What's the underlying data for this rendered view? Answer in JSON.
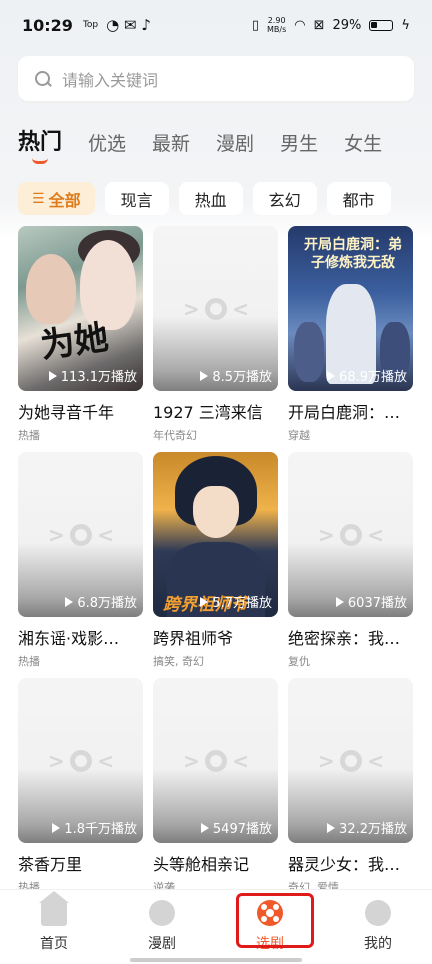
{
  "status_bar": {
    "time": "10:29",
    "mini_label": "Top",
    "net_speed_value": "2.90",
    "net_speed_unit": "MB/s",
    "battery_percent": "29%"
  },
  "search": {
    "placeholder": "请输入关键词"
  },
  "tabs": [
    {
      "label": "热门",
      "active": true
    },
    {
      "label": "优选"
    },
    {
      "label": "最新"
    },
    {
      "label": "漫剧"
    },
    {
      "label": "男生"
    },
    {
      "label": "女生"
    }
  ],
  "chips": [
    {
      "label": "全部",
      "active": true
    },
    {
      "label": "现言"
    },
    {
      "label": "热血"
    },
    {
      "label": "玄幻"
    },
    {
      "label": "都市"
    }
  ],
  "cards": [
    {
      "title": "为她寻音千年",
      "tag": "热播",
      "plays": "113.1万播放",
      "poster_text": "为她"
    },
    {
      "title": "1927 三湾来信",
      "tag": "年代奇幻",
      "plays": "8.5万播放"
    },
    {
      "title": "开局白鹿洞：弟子修炼我无敌",
      "tag": "穿越",
      "plays": "68.9万播放",
      "poster_text": "开局白鹿洞：弟子修炼我无敌"
    },
    {
      "title": "湘东谣·戏影…",
      "tag": "热播",
      "plays": "6.8万播放"
    },
    {
      "title": "跨界祖师爷",
      "tag": "搞笑, 奇幻",
      "plays": "5.7万播放",
      "poster_text": "跨界祖师爷"
    },
    {
      "title": "绝密探亲：我…",
      "tag": "复仇",
      "plays": "6037播放"
    },
    {
      "title": "茶香万里",
      "tag": "热播",
      "plays": "1.8千万播放"
    },
    {
      "title": "头等舱相亲记",
      "tag": "逆袭",
      "plays": "5497播放"
    },
    {
      "title": "器灵少女：我…",
      "tag": "奇幻, 爱情",
      "plays": "32.2万播放"
    }
  ],
  "nav": [
    {
      "label": "首页",
      "icon": "home-icon"
    },
    {
      "label": "漫剧",
      "icon": "comic-icon"
    },
    {
      "label": "选剧",
      "icon": "film-reel-icon",
      "active": true
    },
    {
      "label": "我的",
      "icon": "profile-icon"
    }
  ],
  "colors": {
    "accent": "#f05a2a",
    "chip_active_bg": "#fdeed7",
    "highlight": "#e01919"
  }
}
